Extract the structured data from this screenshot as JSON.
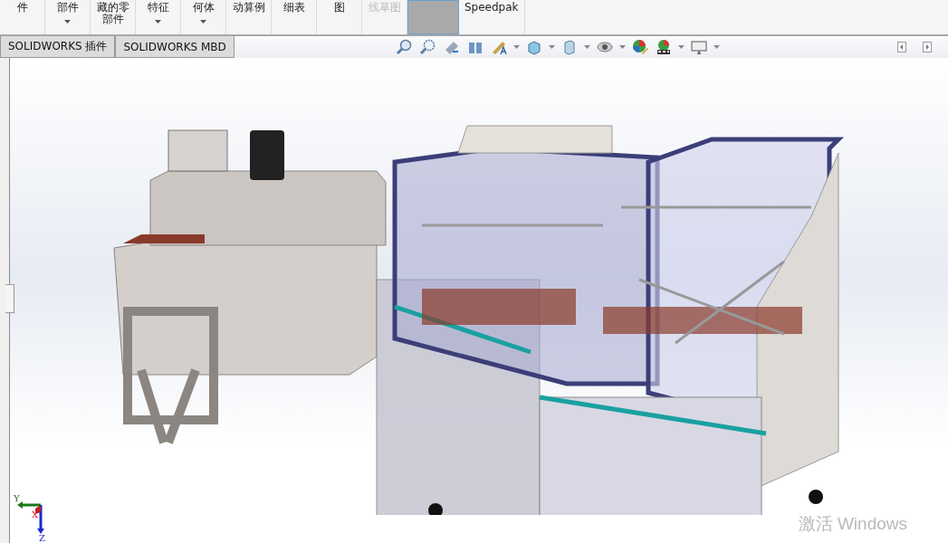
{
  "ribbon": {
    "buttons": [
      {
        "label": "件",
        "dropdown": false,
        "disabled": false,
        "selected": false
      },
      {
        "label": "部件",
        "dropdown": true,
        "disabled": false,
        "selected": false
      },
      {
        "label": "藏的零部件",
        "dropdown": false,
        "disabled": false,
        "selected": false
      },
      {
        "label": "特征",
        "dropdown": true,
        "disabled": false,
        "selected": false
      },
      {
        "label": "何体",
        "dropdown": true,
        "disabled": false,
        "selected": false
      },
      {
        "label": "动算例",
        "dropdown": false,
        "disabled": false,
        "selected": false
      },
      {
        "label": "细表",
        "dropdown": false,
        "disabled": false,
        "selected": false
      },
      {
        "label": "图",
        "dropdown": false,
        "disabled": false,
        "selected": false
      },
      {
        "label": "线草图",
        "dropdown": false,
        "disabled": true,
        "selected": false
      },
      {
        "dropdown": false,
        "disabled": false,
        "selected": true
      },
      {
        "label": "Speedpak",
        "dropdown": false,
        "disabled": false,
        "selected": false
      }
    ]
  },
  "tabs": [
    {
      "label": "SOLIDWORKS 插件",
      "selected": false
    },
    {
      "label": "SOLIDWORKS MBD",
      "selected": false
    }
  ],
  "triad": {
    "y": "Y",
    "x": "X",
    "z": "Z"
  },
  "watermark": {
    "text": "激活 Windows"
  }
}
